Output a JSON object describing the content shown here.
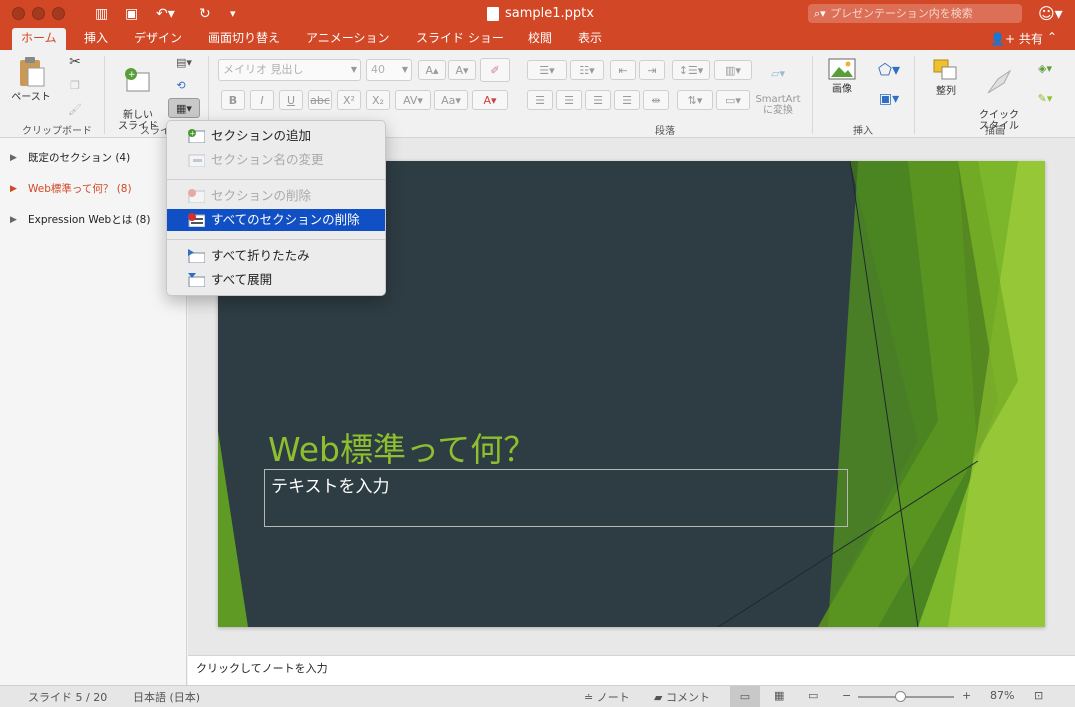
{
  "window": {
    "title": "sample1.pptx",
    "search_placeholder": "プレゼンテーション内を検索"
  },
  "tabs": [
    {
      "label": "ホーム",
      "active": true
    },
    {
      "label": "挿入"
    },
    {
      "label": "デザイン"
    },
    {
      "label": "画面切り替え"
    },
    {
      "label": "アニメーション"
    },
    {
      "label": "スライド ショー"
    },
    {
      "label": "校閲"
    },
    {
      "label": "表示"
    }
  ],
  "share_label": "共有",
  "ribbon": {
    "paste_label": "ペースト",
    "clipboard_group": "クリップボード",
    "new_slide_label": "新しい\nスライド",
    "slides_group": "スライド",
    "font_name": "メイリオ 見出し",
    "font_size": "40",
    "paragraph_group": "段落",
    "smartart_label": "SmartArt\nに変換",
    "image_label": "画像",
    "insert_group": "挿入",
    "arrange_label": "整列",
    "quick_style_label": "クイック\nスタイル",
    "draw_group": "描画"
  },
  "sections": [
    {
      "label": "既定のセクション (4)"
    },
    {
      "label": "Web標準って何？ (8)",
      "active": true
    },
    {
      "label": "Expression Webとは (8)"
    }
  ],
  "menu": {
    "items": [
      {
        "label": "セクションの追加"
      },
      {
        "label": "セクション名の変更",
        "disabled": true
      },
      {
        "label": "セクションの削除",
        "disabled": true
      },
      {
        "label": "すべてのセクションの削除",
        "selected": true
      },
      {
        "label": "すべて折りたたみ"
      },
      {
        "label": "すべて展開"
      }
    ]
  },
  "slide": {
    "title": "Web標準って何？",
    "body_placeholder": "テキストを入力"
  },
  "notes_placeholder": "クリックしてノートを入力",
  "status": {
    "slide_counter": "スライド 5 / 20",
    "language": "日本語 (日本)",
    "notes_label": "ノート",
    "comments_label": "コメント",
    "zoom": "87%",
    "zoom_level": 0.87
  },
  "colors": {
    "accent": "#d24726",
    "slide_bg": "#2e3c43",
    "slide_title": "#8dbf2e",
    "menu_highlight": "#1150c4"
  }
}
